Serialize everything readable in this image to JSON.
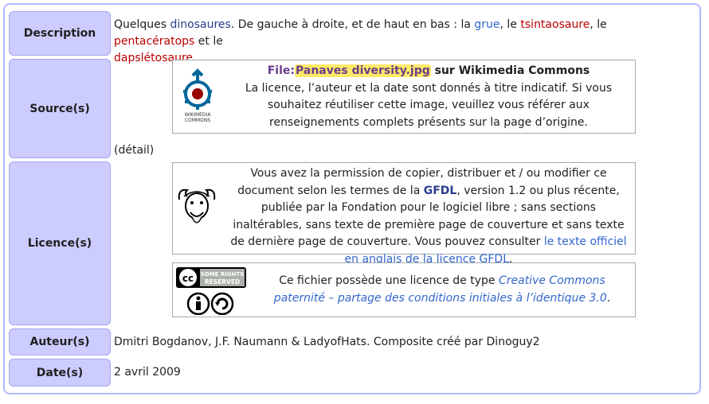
{
  "headers": {
    "description": "Description",
    "source": "Source(s)",
    "licence": "Licence(s)",
    "auteur": "Auteur(s)",
    "date": "Date(s)"
  },
  "description": {
    "t1": "Quelques ",
    "link_dinosaures": "dinosaures",
    "t2": ". De gauche à droite, et de haut en bas : la ",
    "link_grue": "grue",
    "t3": ", le ",
    "link_tsintaosaure": "tsintaosaure",
    "t4": ", le ",
    "link_pentaceratops": "pentacératops",
    "t5": " et le",
    "link_dapsletosaure": "dapslétosaure"
  },
  "commons_box": {
    "file_prefix": "File:",
    "file_name": "Panaves diversity.jpg",
    "file_suffix": " sur Wikimedia Commons",
    "text": "La licence, l’auteur et la date sont donnés à titre indicatif. Si vous souhaitez réutiliser cette image, veuillez vous référer aux renseignements complets présents sur la page d’origine.",
    "logo_label_1": "WIKIMEDIA",
    "logo_label_2": "COMMONS"
  },
  "detail_text": "(détail)",
  "gfdl_box": {
    "t1": "Vous avez la permission de copier, distribuer et / ou modifier ce document selon les termes de la ",
    "gfdl_link": "GFDL",
    "t2": ", version 1.2 ou plus récente, publiée par la Fondation pour le logiciel libre ; sans sections inaltérables, sans texte de première page de couverture et sans texte de dernière page de couverture. Vous pouvez consulter ",
    "official_link": "le texte officiel en anglais de la licence GFDL",
    "t3": "."
  },
  "cc_box": {
    "t1": "Ce fichier possède une licence de type ",
    "cc_link": "Creative Commons paternité – partage des conditions initiales à l’identique 3.0",
    "t2": ".",
    "badge_line1": "SOME RIGHTS",
    "badge_line2": "RESERVED"
  },
  "auteur_text": "Dmitri Bogdanov, J.F. Naumann & LadyofHats. Composite créé par Dinoguy2",
  "date_text": "2 avril 2009",
  "colors": {
    "header_bg": "#ccccff",
    "frame_border": "#b3b7ff",
    "link_blue": "#3366cc",
    "link_red": "#ba0000",
    "highlight": "#fde968"
  }
}
